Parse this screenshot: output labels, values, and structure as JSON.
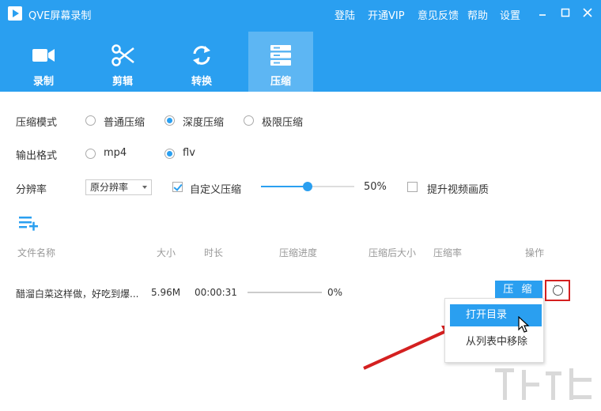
{
  "app": {
    "title": "QVE屏幕录制",
    "header_links": [
      "登陆",
      "开通VIP",
      "意见反馈",
      "帮助",
      "设置"
    ],
    "window_controls": {
      "minimize_icon": "minimize-icon",
      "maximize_icon": "maximize-icon",
      "close_icon": "close-icon"
    }
  },
  "tabs": [
    {
      "label": "录制",
      "icon": "video-camera-icon",
      "active": false
    },
    {
      "label": "剪辑",
      "icon": "scissors-icon",
      "active": false
    },
    {
      "label": "转换",
      "icon": "convert-icon",
      "active": false
    },
    {
      "label": "压缩",
      "icon": "compress-icon",
      "active": true
    }
  ],
  "settings": {
    "compress_mode": {
      "label": "压缩模式",
      "options": [
        "普通压缩",
        "深度压缩",
        "极限压缩"
      ],
      "selected": "深度压缩"
    },
    "output_format": {
      "label": "输出格式",
      "options": [
        "mp4",
        "flv"
      ],
      "selected": "flv"
    },
    "resolution": {
      "label": "分辨率",
      "value": "原分辨率"
    },
    "custom_compress": {
      "label": "自定义压缩",
      "checked": true,
      "slider_value": 50,
      "value_text": "50%"
    },
    "enhance_quality": {
      "label": "提升视频画质",
      "checked": false
    }
  },
  "table": {
    "columns": [
      "文件名称",
      "大小",
      "时长",
      "压缩进度",
      "压缩后大小",
      "压缩率",
      "操作"
    ],
    "rows": [
      {
        "name": "醋溜白菜这样做，好吃到爆...",
        "size": "5.96M",
        "duration": "00:00:31",
        "progress": 0,
        "progress_text": "0%",
        "compressed_size": "",
        "ratio": "",
        "action_label": "压 缩"
      }
    ]
  },
  "context_menu": {
    "items": [
      "打开目录",
      "从列表中移除"
    ],
    "highlighted": "打开目录"
  },
  "colors": {
    "brand": "#2a9ff0",
    "tab_active": "#5db6f3",
    "annotation": "#d42020"
  }
}
